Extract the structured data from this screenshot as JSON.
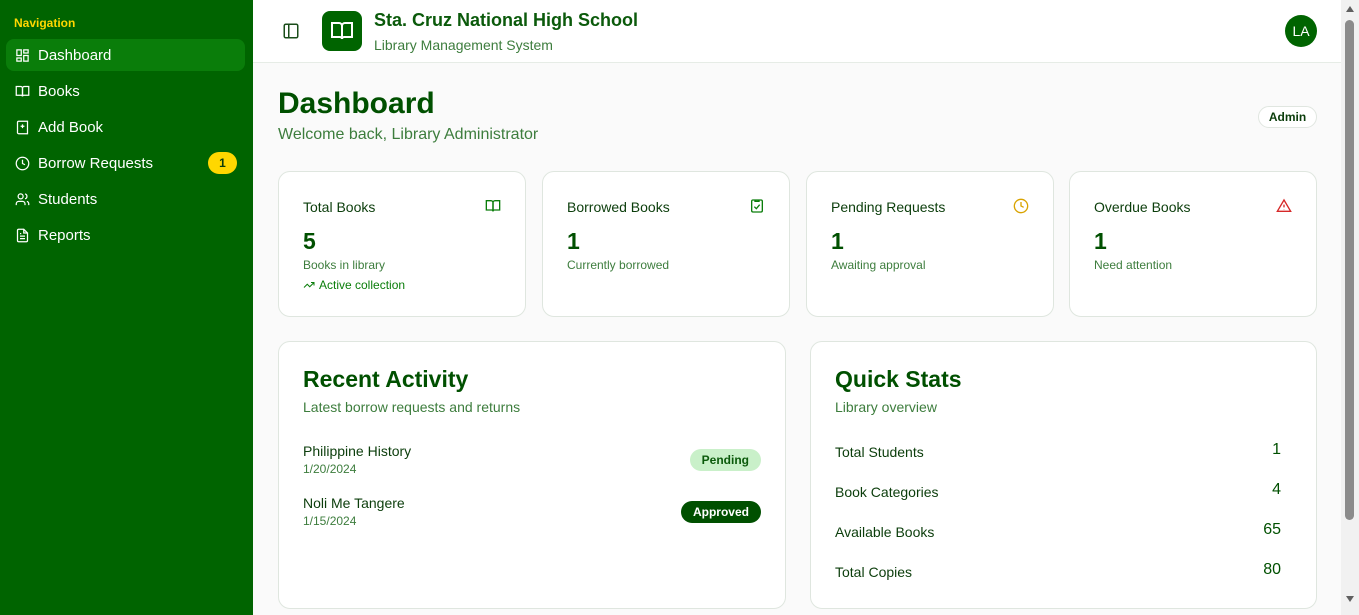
{
  "sidebar": {
    "title": "Navigation",
    "items": [
      {
        "label": "Dashboard",
        "icon": "dashboard-icon",
        "active": true
      },
      {
        "label": "Books",
        "icon": "book-open-icon"
      },
      {
        "label": "Add Book",
        "icon": "add-book-icon"
      },
      {
        "label": "Borrow Requests",
        "icon": "clock-icon",
        "badge": "1"
      },
      {
        "label": "Students",
        "icon": "users-icon"
      },
      {
        "label": "Reports",
        "icon": "file-text-icon"
      }
    ]
  },
  "header": {
    "school_name": "Sta. Cruz National High School",
    "system_name": "Library Management System",
    "avatar_initials": "LA"
  },
  "main": {
    "title": "Dashboard",
    "subtitle": "Welcome back, Library Administrator",
    "role_badge": "Admin",
    "stats": [
      {
        "label": "Total Books",
        "value": "5",
        "desc": "Books in library",
        "trend": "Active collection",
        "icon": "book-open-icon",
        "icon_color": "#0a7d0a"
      },
      {
        "label": "Borrowed Books",
        "value": "1",
        "desc": "Currently borrowed",
        "icon": "clipboard-check-icon",
        "icon_color": "#0a7d0a"
      },
      {
        "label": "Pending Requests",
        "value": "1",
        "desc": "Awaiting approval",
        "icon": "clock-icon",
        "icon_color": "#d9a300"
      },
      {
        "label": "Overdue Books",
        "value": "1",
        "desc": "Need attention",
        "icon": "alert-triangle-icon",
        "icon_color": "#d62828"
      }
    ],
    "recent_activity": {
      "title": "Recent Activity",
      "subtitle": "Latest borrow requests and returns",
      "items": [
        {
          "title": "Philippine History",
          "date": "1/20/2024",
          "status": "Pending"
        },
        {
          "title": "Noli Me Tangere",
          "date": "1/15/2024",
          "status": "Approved"
        }
      ]
    },
    "quick_stats": {
      "title": "Quick Stats",
      "subtitle": "Library overview",
      "items": [
        {
          "label": "Total Students",
          "value": "1"
        },
        {
          "label": "Book Categories",
          "value": "4"
        },
        {
          "label": "Available Books",
          "value": "65"
        },
        {
          "label": "Total Copies",
          "value": "80"
        }
      ]
    }
  },
  "colors": {
    "sidebar_bg": "#006400",
    "accent_yellow": "#ffd700",
    "primary_green": "#005000"
  }
}
